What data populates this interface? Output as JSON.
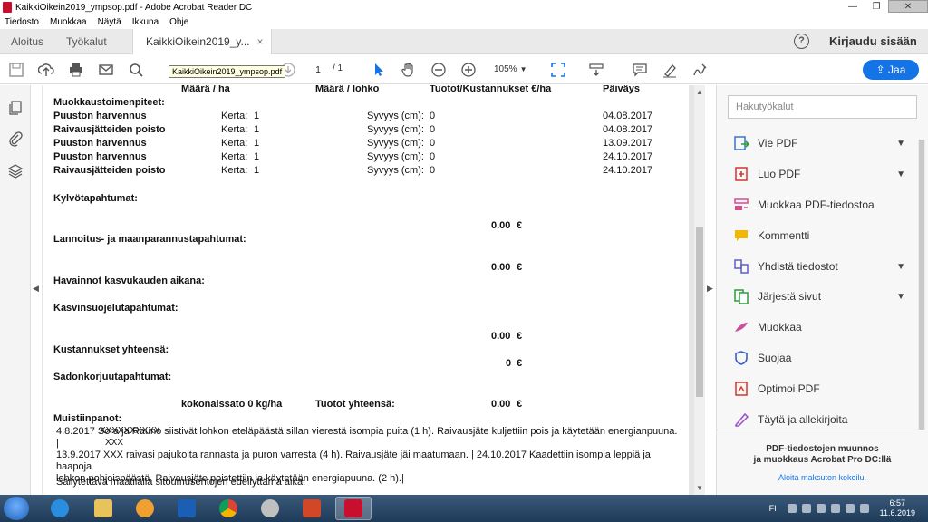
{
  "window": {
    "title": "KaikkiOikein2019_ympsop.pdf - Adobe Acrobat Reader DC",
    "minimize": "—",
    "maximize": "❐",
    "close": "✕"
  },
  "menu": [
    "Tiedosto",
    "Muokkaa",
    "Näytä",
    "Ikkuna",
    "Ohje"
  ],
  "tabs": {
    "home": "Aloitus",
    "tools": "Työkalut",
    "document": "KaikkiOikein2019_y...",
    "close": "×"
  },
  "header": {
    "help": "?",
    "signin": "Kirjaudu sisään"
  },
  "toolbar": {
    "page_current": "1",
    "page_total": "/ 1",
    "zoom": "105%",
    "share": "Jaa",
    "tooltip": "KaikkiOikein2019_ympsop.pdf"
  },
  "document": {
    "headers": [
      "Määrä / ha",
      "Määrä / lohko",
      "Tuotot/Kustannukset €/ha",
      "Päiväys"
    ],
    "operations_title": "Muokkaustoimenpiteet:",
    "operations": [
      {
        "name": "Puuston harvennus",
        "times_label": "Kerta:",
        "times": "1",
        "depth_label": "Syvyys (cm):",
        "depth": "0",
        "date": "04.08.2017"
      },
      {
        "name": "Raivausjätteiden poisto",
        "times_label": "Kerta:",
        "times": "1",
        "depth_label": "Syvyys (cm):",
        "depth": "0",
        "date": "04.08.2017"
      },
      {
        "name": "Puuston harvennus",
        "times_label": "Kerta:",
        "times": "1",
        "depth_label": "Syvyys (cm):",
        "depth": "0",
        "date": "13.09.2017"
      },
      {
        "name": "Puuston harvennus",
        "times_label": "Kerta:",
        "times": "1",
        "depth_label": "Syvyys (cm):",
        "depth": "0",
        "date": "24.10.2017"
      },
      {
        "name": "Raivausjätteiden poisto",
        "times_label": "Kerta:",
        "times": "1",
        "depth_label": "Syvyys (cm):",
        "depth": "0",
        "date": "24.10.2017"
      }
    ],
    "sowing_title": "Kylvötapahtumat:",
    "sowing_total": "0.00",
    "fertilizing_title": "Lannoitus- ja maanparannustapahtumat:",
    "fertilizing_total": "0.00",
    "observations_title": "Havainnot kasvukauden aikana:",
    "plantprotection_title": "Kasvinsuojelutapahtumat:",
    "plantprotection_total": "0.00",
    "costs_title": "Kustannukset yhteensä:",
    "costs_total": "0",
    "harvest_title": "Sadonkorjuutapahtumat:",
    "harvest_amount_label": "kokonaissato 0  kg/ha",
    "harvest_income_label": "Tuotot yhteensä:",
    "harvest_income": "0.00",
    "currency": "€",
    "notes_title": "Muistiinpanot:",
    "notes_overlay_1": "XXXXXXXXXX",
    "notes_overlay_2": "XXX",
    "notes_line_1": "4.8.2017 Sora ja Rauno siistivät lohkon eteläpäästä sillan vierestä isompia puita (1 h). Raivausjäte kuljettiin pois ja käytetään energianpuuna. |",
    "notes_line_2": "13.9.2017 XXX raivasi pajukoita rannasta ja puron varresta (4 h). Raivausjäte jäi maatumaan. | 24.10.2017 Kaadettiin isompia leppiä ja haapoja",
    "notes_line_3": "lohkon pohjoispäästä. Raivausjäte poistettiin ja käytetään energiapuuna. (2 h).|",
    "storage_note": "Säilytettävä maatilalla sitoumusehtojen edellyttämä aika."
  },
  "rightpane": {
    "search_placeholder": "Hakutyökalut",
    "tools": [
      {
        "label": "Vie PDF",
        "icon": "export-pdf-icon",
        "color": "#3b73c8",
        "expandable": true
      },
      {
        "label": "Luo PDF",
        "icon": "create-pdf-icon",
        "color": "#d9342b",
        "expandable": true
      },
      {
        "label": "Muokkaa PDF-tiedostoa",
        "icon": "edit-pdf-icon",
        "color": "#d94a8c",
        "expandable": false
      },
      {
        "label": "Kommentti",
        "icon": "comment-icon",
        "color": "#f2b705",
        "expandable": false
      },
      {
        "label": "Yhdistä tiedostot",
        "icon": "combine-files-icon",
        "color": "#5b5fc7",
        "expandable": true
      },
      {
        "label": "Järjestä sivut",
        "icon": "organize-pages-icon",
        "color": "#2e9a3e",
        "expandable": true
      },
      {
        "label": "Muokkaa",
        "icon": "edit-icon",
        "color": "#c94f9b",
        "expandable": false
      },
      {
        "label": "Suojaa",
        "icon": "protect-icon",
        "color": "#3b5fc8",
        "expandable": false
      },
      {
        "label": "Optimoi PDF",
        "icon": "optimize-pdf-icon",
        "color": "#d9342b",
        "expandable": false
      },
      {
        "label": "Täytä ja allekirjoita",
        "icon": "fill-sign-icon",
        "color": "#9b4fc9",
        "expandable": false
      }
    ],
    "promo_line_1": "PDF-tiedostojen muunnos",
    "promo_line_2": "ja muokkaus Acrobat Pro DC:llä",
    "promo_link": "Aloita maksuton kokeilu."
  },
  "taskbar": {
    "lang": "FI",
    "time": "6:57",
    "date": "11.6.2019"
  },
  "colors": {
    "accent": "#1473e6",
    "acrobat_red": "#c8102e"
  }
}
